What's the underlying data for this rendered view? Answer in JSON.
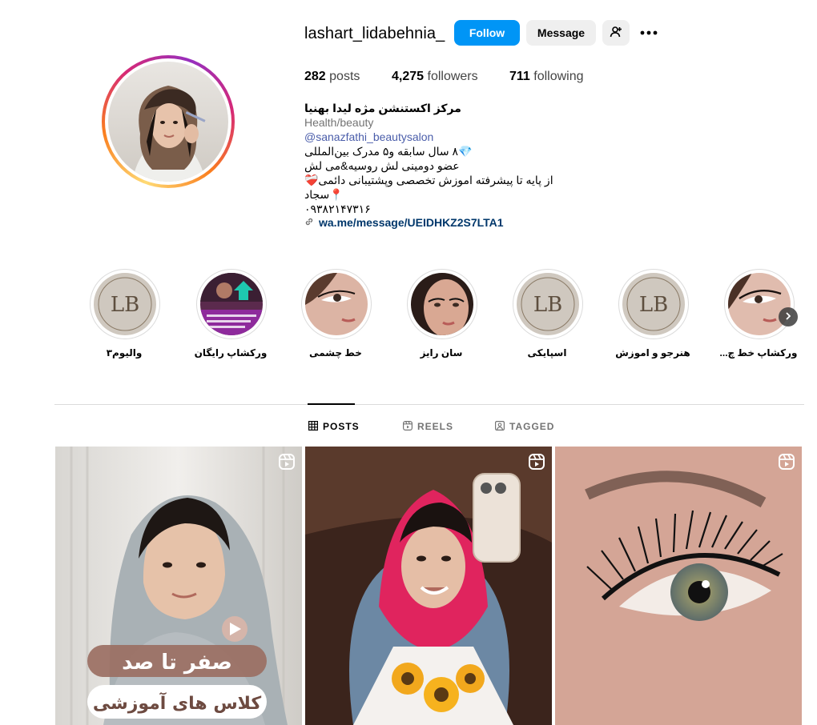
{
  "profile": {
    "username": "lashart_lidabehnia_",
    "follow_label": "Follow",
    "message_label": "Message",
    "stats": {
      "posts_count": "282",
      "posts_label": "posts",
      "followers_count": "4,275",
      "followers_label": "followers",
      "following_count": "711",
      "following_label": "following"
    },
    "bio": {
      "name": "مرکز اکستنشن مژه لیدا بهنیا",
      "category": "Health/beauty",
      "mention": "@sanazfathi_beautysalon",
      "lines": [
        "💎۸ سال سابقه و۵ مدرک بین‌المللی",
        "عضو دومینی لش روسیه&می لش",
        "از پایه تا پیشرفته اموزش تخصصی وپشتیبانی دائمی❤️‍🩹",
        "📍سجاد",
        "۰۹۳۸۲۱۴۷۳۱۶"
      ],
      "link": "wa.me/message/UEIDHKZ2S7LTA1"
    }
  },
  "highlights": [
    {
      "label": "والیوم۳"
    },
    {
      "label": "ورکشاپ رایگان"
    },
    {
      "label": "خط چشمی"
    },
    {
      "label": "سان رایز"
    },
    {
      "label": "اسپایکی"
    },
    {
      "label": "هنرجو و اموزش"
    },
    {
      "label": "ورکشاپ خط چ..."
    }
  ],
  "tabs": {
    "posts": "POSTS",
    "reels": "REELS",
    "tagged": "TAGGED",
    "active": "posts"
  },
  "posts": {
    "post1_title": "صفر تا صد",
    "post1_subtitle": "کلاس های آموزشی"
  },
  "colors": {
    "accent": "#0095f6",
    "link": "#00376b",
    "mention": "#4a5daa"
  }
}
